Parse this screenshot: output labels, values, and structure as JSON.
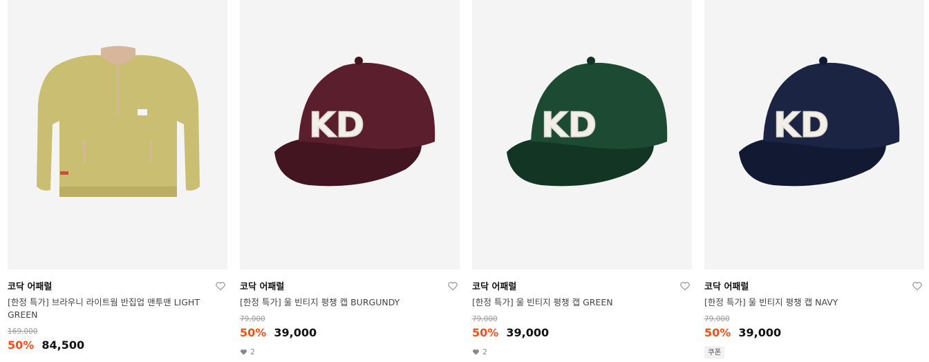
{
  "products": [
    {
      "brand": "코닥 어패럴",
      "title": "[한정 특가] 브라우니 라이트웜 반집업 맨투맨 LIGHT GREEN",
      "original_price": "169,000",
      "discount": "50%",
      "price": "84,500",
      "image_icon": "sweatshirt-image",
      "body_color": "#c9be72",
      "collar_color": "#d7b79c"
    },
    {
      "brand": "코닥 어패럴",
      "title": "[한정 특가] 울 빈티지 평챙 캡 BURGUNDY",
      "original_price": "79,000",
      "discount": "50%",
      "price": "39,000",
      "likes": "2",
      "image_icon": "cap-image",
      "cap_color": "#5a1e2c",
      "cap_shade": "#431520",
      "logo": "KD"
    },
    {
      "brand": "코닥 어패럴",
      "title": "[한정 특가] 울 빈티지 평챙 캡 GREEN",
      "original_price": "79,000",
      "discount": "50%",
      "price": "39,000",
      "likes": "2",
      "image_icon": "cap-image",
      "cap_color": "#1d4a32",
      "cap_shade": "#133523",
      "logo": "KD"
    },
    {
      "brand": "코닥 어패럴",
      "title": "[한정 특가] 울 빈티지 평챙 캡 NAVY",
      "original_price": "79,000",
      "discount": "50%",
      "price": "39,000",
      "coupon": "쿠폰",
      "image_icon": "cap-image",
      "cap_color": "#1b2443",
      "cap_shade": "#121a33",
      "logo": "KD"
    }
  ],
  "icons": {
    "wishlist": "heart-outline-icon",
    "likes": "heart-filled-icon"
  },
  "colors": {
    "discount": "#ff4a12",
    "thumb_bg": "#f4f4f4"
  }
}
